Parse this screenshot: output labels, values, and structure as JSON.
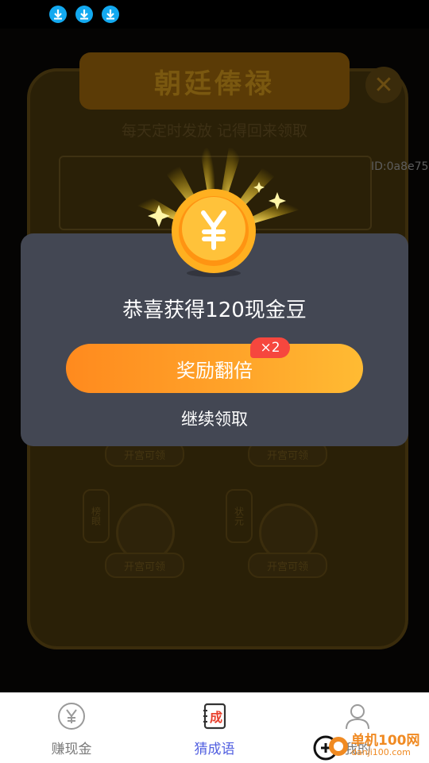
{
  "status_bar": {
    "icons": [
      "download-icon",
      "download-icon",
      "download-icon"
    ]
  },
  "background_page": {
    "title": "朝廷俸禄",
    "subtitle": "每天定时发放 记得回来领取",
    "id_text": "ID:0a8e75",
    "coin_buttons": [
      "开宫可领",
      "开宫可领",
      "开宫可领",
      "开宫可领"
    ],
    "tags": [
      "状元",
      "榜眼"
    ]
  },
  "dialog": {
    "title": "恭喜获得120现金豆",
    "double_button_label": "奖励翻倍",
    "multiplier_badge": "×2",
    "continue_label": "继续领取"
  },
  "tab_bar": {
    "tabs": [
      {
        "label": "赚现金",
        "icon": "yuan-coin-icon",
        "active": false
      },
      {
        "label": "猜成语",
        "icon": "idiom-book-icon",
        "icon_text": "成",
        "active": true
      },
      {
        "label": "我的",
        "icon": "user-icon",
        "active": false
      }
    ]
  },
  "watermark": {
    "line1": "单机100网",
    "line2": "danji100.com"
  },
  "colors": {
    "accent": "#5260e0",
    "button": "#ffa52a",
    "badge": "#f6473e",
    "dialog": "#434753"
  }
}
